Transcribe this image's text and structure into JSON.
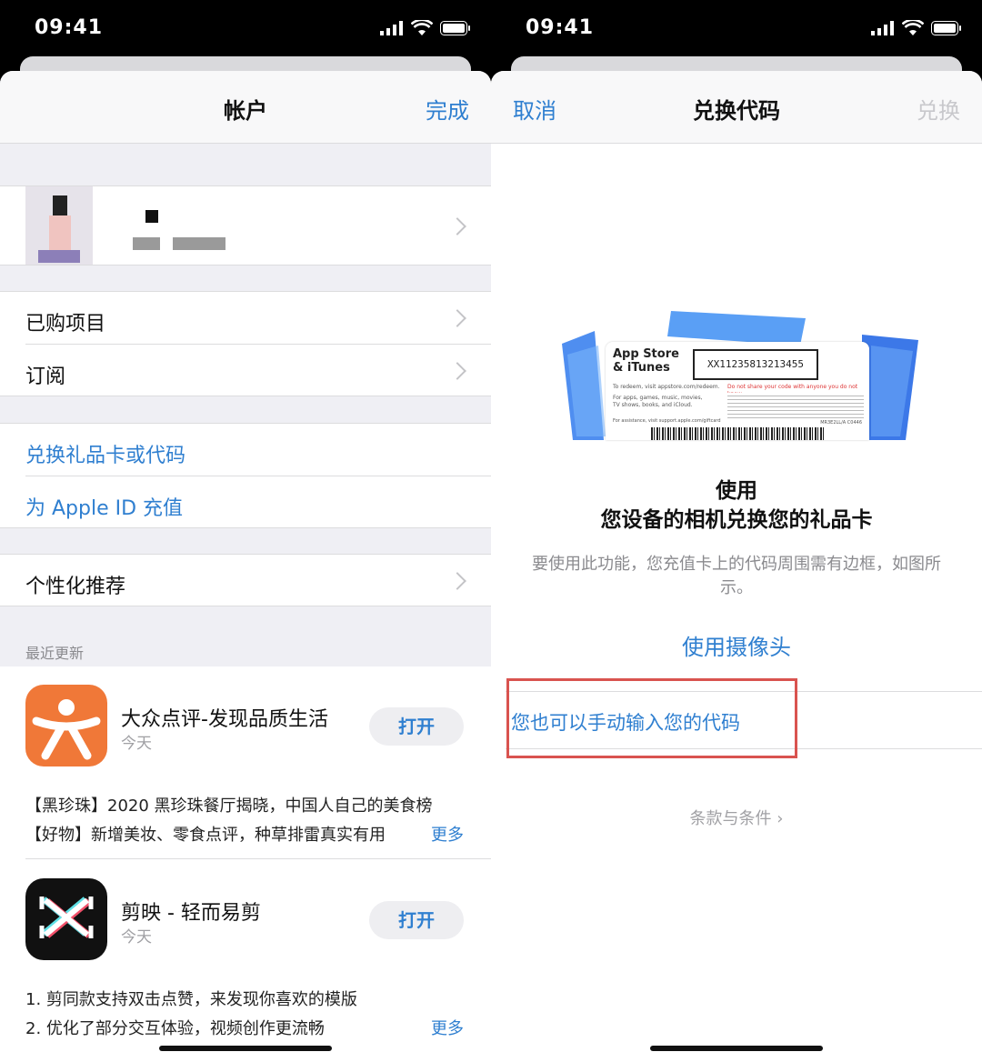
{
  "left": {
    "status": {
      "time": "09:41"
    },
    "nav": {
      "title": "帐户",
      "done": "完成"
    },
    "menu": {
      "purchased": "已购项目",
      "subscriptions": "订阅",
      "redeem": "兑换礼品卡或代码",
      "add_funds": "为 Apple ID 充值",
      "personalized": "个性化推荐"
    },
    "recent_header": "最近更新",
    "apps": [
      {
        "name": "大众点评-发现品质生活",
        "date": "今天",
        "button": "打开",
        "notes": [
          "【黑珍珠】2020 黑珍珠餐厅揭晓，中国人自己的美食榜",
          "【好物】新增美妆、零食点评，种草排雷真实有用"
        ],
        "more": "更多",
        "icon_color": "#f07838"
      },
      {
        "name": "剪映 - 轻而易剪",
        "date": "今天",
        "button": "打开",
        "notes": [
          "1. 剪同款支持双击点赞，来发现你喜欢的模版",
          "2. 优化了部分交互体验，视频创作更流畅"
        ],
        "more": "更多",
        "icon_color": "#111111"
      }
    ]
  },
  "right": {
    "status": {
      "time": "09:41"
    },
    "nav": {
      "cancel": "取消",
      "title": "兑换代码",
      "redeem": "兑换"
    },
    "card": {
      "brand_line1": "App Store",
      "brand_line2": "& iTunes",
      "code": "XX11235813213455",
      "redeem_hint": "To redeem, visit appstore.com/redeem.",
      "apps_hint": "For apps, games, music, movies, TV shows, books, and iCloud.",
      "warning": "Do not share your code with anyone you do not know.",
      "assist": "For assistance, visit support.apple.com/giftcard",
      "serial": "MR3E2LL/A C0446"
    },
    "heading_line1": "使用",
    "heading_line2": "您设备的相机兑换您的礼品卡",
    "description": "要使用此功能，您充值卡上的代码周围需有边框，如图所示。",
    "use_camera": "使用摄像头",
    "manual_entry": "您也可以手动输入您的代码",
    "terms": "条款与条件 ›"
  },
  "colors": {
    "accent": "#2f7fd0",
    "highlight_box": "#d9534f",
    "background_gray": "#efeff4"
  }
}
